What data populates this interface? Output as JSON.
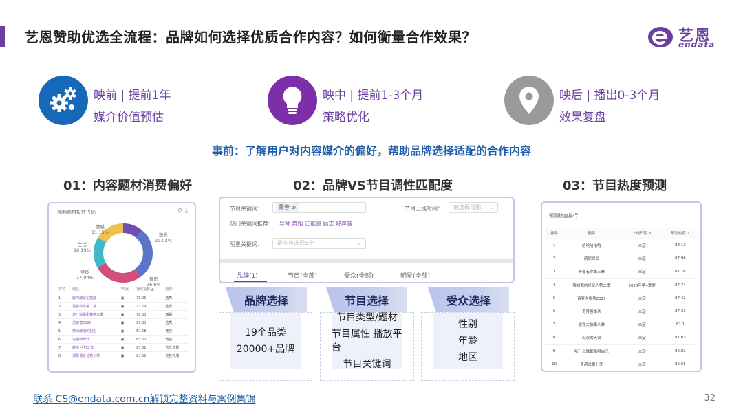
{
  "title": "艺恩赞助优选全流程：品牌如何选择优质合作内容？如何衡量合作效果？",
  "logo": {
    "cn": "艺恩",
    "en": "endata"
  },
  "phases": [
    {
      "icon": "gears-icon",
      "color": "#1669b8",
      "line1": "映前 | 提前1年",
      "line2": "媒介价值预估"
    },
    {
      "icon": "lightbulb-icon",
      "color": "#7b2fa8",
      "line1": "映中 | 提前1-3个月",
      "line2": "策略优化"
    },
    {
      "icon": "location-pin-icon",
      "color": "#9a9a9a",
      "line1": "映后 | 播出0-3个月",
      "line2": "效果复盘"
    }
  ],
  "subheading": "事前：了解用户对内容媒介的偏好，帮助品牌选择适配的合作内容",
  "columns": [
    {
      "title": "01：内容题材消费偏好"
    },
    {
      "title": "02：品牌VS节目调性匹配度"
    },
    {
      "title": "03：节目热度预测"
    }
  ],
  "card1": {
    "title": "视频题材投放占比",
    "tools": "⟳ ⤓",
    "donut": [
      {
        "label": "情感",
        "pct": "11.15%",
        "value": 11.15,
        "color": "#6f4fb0"
      },
      {
        "label": "选秀",
        "pct": "29.02%",
        "value": 29.02,
        "color": "#5a74c8"
      },
      {
        "label": "音乐",
        "pct": "26.6%",
        "value": 26.6,
        "color": "#d24f7a"
      },
      {
        "label": "竞技",
        "pct": "17.04%",
        "value": 17.04,
        "color": "#3fb8c8"
      },
      {
        "label": "生活",
        "pct": "16.19%",
        "value": 16.19,
        "color": "#f0c050"
      }
    ],
    "headers": [
      "排名",
      "题名",
      "VS比",
      "播映指数 ▲",
      "题材"
    ],
    "rows": [
      [
        "1",
        "脚内破疑招能能",
        "▣",
        "75.06",
        "选秀"
      ],
      [
        "2",
        "青春有你第二季",
        "▣",
        "73.79",
        "选秀"
      ],
      [
        "3",
        "这！就是街舞第三季",
        "▣",
        "70.33",
        "舞蹈"
      ],
      [
        "4",
        "创造营2020",
        "▣",
        "69.83",
        "选秀"
      ],
      [
        "5",
        "乘风破浪的姐姐",
        "▣",
        "67.58",
        "竞技"
      ],
      [
        "6",
        "说唱新世代",
        "▣",
        "65.60",
        "竞技"
      ],
      [
        "7",
        "歌手 当打之年",
        "▣",
        "65.61",
        "音乐竞技"
      ],
      [
        "8",
        "演员请就位第二季",
        "▣",
        "63.52",
        "竞技养成"
      ]
    ]
  },
  "card2": {
    "keyword_label": "节目关键词：",
    "keyword_tag": "青春 ⊗",
    "online_label": "节目上线时间：",
    "online_placeholder": "请选择日期",
    "hot_label": "热门关键词推荐：",
    "hot_words": "导师  舞蹈  正能量  励志  好声音",
    "star_label": "明星关键词：",
    "star_placeholder": "最多可选择5个",
    "tabs": [
      "品牌(1)",
      "节目(全部)",
      "受众(全部)",
      "明星(全部)"
    ]
  },
  "selections": [
    {
      "header": "品牌选择",
      "lines": [
        "19个品类",
        "20000+品牌"
      ]
    },
    {
      "header": "节目选择",
      "lines": [
        "节目类型/题材",
        "节目属性 播放平台",
        "节目关键词"
      ]
    },
    {
      "header": "受众选择",
      "lines": [
        "性别",
        "年龄",
        "地区"
      ]
    }
  ],
  "card3": {
    "title": "预测热度排行",
    "headers": [
      "排名",
      "剧名",
      "上线日期 ⇕",
      "预测热度 ⇕"
    ],
    "rows": [
      [
        "1",
        "哈哈哈哈哈",
        "未定",
        "88.13"
      ],
      [
        "2",
        "萌探探探",
        "未定",
        "87.96"
      ],
      [
        "3",
        "青春有你第三季",
        "未定",
        "87.76"
      ],
      [
        "4",
        "我知我的经纪人第二季",
        "2020年第4季度",
        "87.74"
      ],
      [
        "5",
        "百变大咖秀2021",
        "未定",
        "87.42"
      ],
      [
        "6",
        "奇异剧本杀",
        "未定",
        "87.33"
      ],
      [
        "7",
        "最强大脑第八季",
        "未定",
        "87.1"
      ],
      [
        "8",
        "深夜的天台",
        "未定",
        "87.03"
      ],
      [
        "9",
        "听什么歌都像唱自己",
        "未定",
        "86.82"
      ],
      [
        "10",
        "奇葩说第七季",
        "未定",
        "86.65"
      ]
    ]
  },
  "footer": {
    "link": "联系 CS@endata.com.cn解锁完整资料与案例集锦",
    "page": "32"
  }
}
